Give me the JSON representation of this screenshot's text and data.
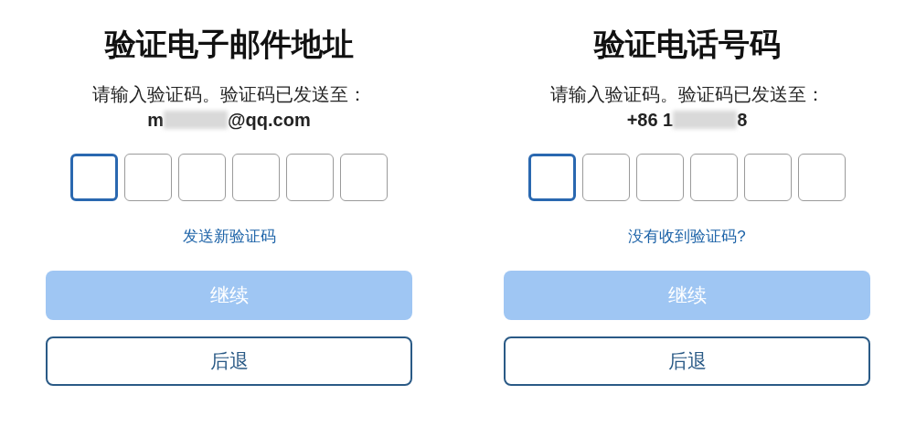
{
  "panels": [
    {
      "title": "验证电子邮件地址",
      "instruction": "请输入验证码。验证码已发送至：",
      "contact": {
        "prefix": "m",
        "suffix": "@qq.com"
      },
      "code_boxes": [
        {
          "selected": true
        },
        {
          "selected": false
        },
        {
          "selected": false
        },
        {
          "selected": false
        },
        {
          "selected": false
        },
        {
          "selected": false
        }
      ],
      "link": "发送新验证码",
      "buttons": [
        {
          "kind": "primary",
          "label": "继续",
          "disabled": true
        },
        {
          "kind": "secondary",
          "label": "后退",
          "disabled": false
        }
      ]
    },
    {
      "title": "验证电话号码",
      "instruction": "请输入验证码。验证码已发送至：",
      "contact": {
        "prefix": "+86 1",
        "suffix": "8"
      },
      "code_boxes": [
        {
          "selected": true
        },
        {
          "selected": false
        },
        {
          "selected": false
        },
        {
          "selected": false
        },
        {
          "selected": false
        },
        {
          "selected": false
        }
      ],
      "link": "没有收到验证码?",
      "buttons": [
        {
          "kind": "primary",
          "label": "继续",
          "disabled": true
        },
        {
          "kind": "secondary",
          "label": "后退",
          "disabled": false
        }
      ]
    }
  ]
}
